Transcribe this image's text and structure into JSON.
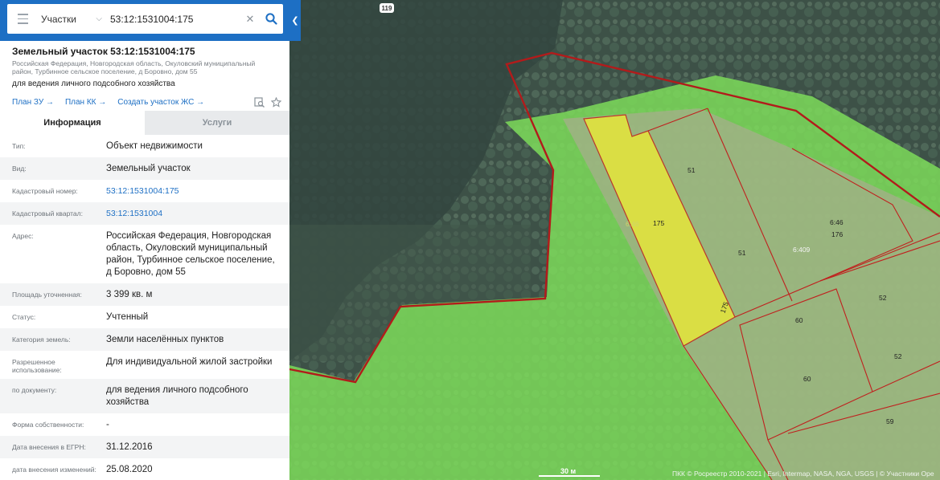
{
  "search": {
    "layer": "Участки",
    "query": "53:12:1531004:175"
  },
  "header": {
    "title": "Земельный участок 53:12:1531004:175",
    "address": "Российская Федерация, Новгородская область, Окуловский муниципальный район, Турбинное сельское поселение, д Боровно, дом 55",
    "purpose": "для ведения личного подсобного хозяйства"
  },
  "links": [
    {
      "label": "План ЗУ →"
    },
    {
      "label": "План КК →"
    },
    {
      "label": "Создать участок ЖС →"
    }
  ],
  "tabs": [
    {
      "label": "Информация",
      "active": true
    },
    {
      "label": "Услуги",
      "active": false
    }
  ],
  "rows": [
    {
      "label": "Тип:",
      "value": "Объект недвижимости"
    },
    {
      "label": "Вид:",
      "value": "Земельный участок"
    },
    {
      "label": "Кадастровый номер:",
      "value": "53:12:1531004:175",
      "link": true
    },
    {
      "label": "Кадастровый квартал:",
      "value": "53:12:1531004",
      "link": true
    },
    {
      "label": "Адрес:",
      "value": "Российская Федерация, Новгородская область, Окуловский муниципальный район, Турбинное сельское поселение, д Боровно, дом 55"
    },
    {
      "label": "Площадь уточненная:",
      "value": "3 399 кв. м"
    },
    {
      "label": "Статус:",
      "value": "Учтенный"
    },
    {
      "label": "Категория земель:",
      "value": "Земли населённых пунктов"
    },
    {
      "label": "Разрешенное использование:",
      "value": "Для индивидуальной жилой застройки"
    },
    {
      "label": "по документу:",
      "value": "для ведения личного подсобного хозяйства"
    },
    {
      "label": "Форма собственности:",
      "value": "-"
    },
    {
      "label": "Дата внесения в ЕГРН:",
      "value": "31.12.2016"
    },
    {
      "label": "дата внесения изменений:",
      "value": "25.08.2020"
    }
  ],
  "map": {
    "road_number": "119",
    "parcel_labels": [
      "51",
      "6:46",
      "175",
      "51",
      "6:409",
      "6:46",
      "176",
      "52",
      "60",
      "60",
      "52",
      "59",
      "175"
    ],
    "scale": "30 м",
    "attribution": "ПКК © Росреестр 2010-2021 | Esri, Intermap, NASA, NGA, USGS | © Участники Ope"
  },
  "colors": {
    "accent": "#1d6fc4",
    "selected_parcel": "#e6e63a",
    "zone_fill": "#7fe05a",
    "boundary": "#c0201e"
  },
  "icons": [
    "menu-icon",
    "chevron-down-icon",
    "close-icon",
    "search-icon",
    "chevron-left-icon",
    "find-on-map-icon",
    "star-icon"
  ]
}
